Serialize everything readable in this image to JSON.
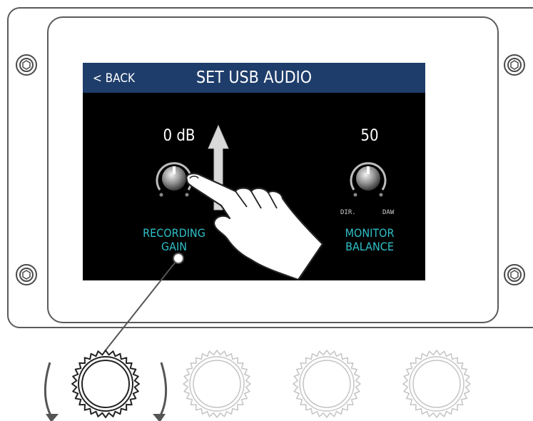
{
  "screen": {
    "back_label": "< BACK",
    "title": "SET USB AUDIO"
  },
  "params": [
    {
      "value": "0 dB",
      "label_line1": "RECORDING",
      "label_line2": "GAIN"
    },
    {
      "value": "50",
      "label_line1": "MONITOR",
      "label_line2": "BALANCE",
      "left_end": "DIR.",
      "right_end": "DAW"
    }
  ],
  "colors": {
    "titlebar": "#1e3d6b",
    "label": "#2fc0c9",
    "screen_bg": "#000000"
  },
  "icons": [
    "screw-icon",
    "knob-icon",
    "up-arrow-icon",
    "pointing-hand-icon",
    "rotate-arrow-icon",
    "encoder-knob-icon"
  ]
}
